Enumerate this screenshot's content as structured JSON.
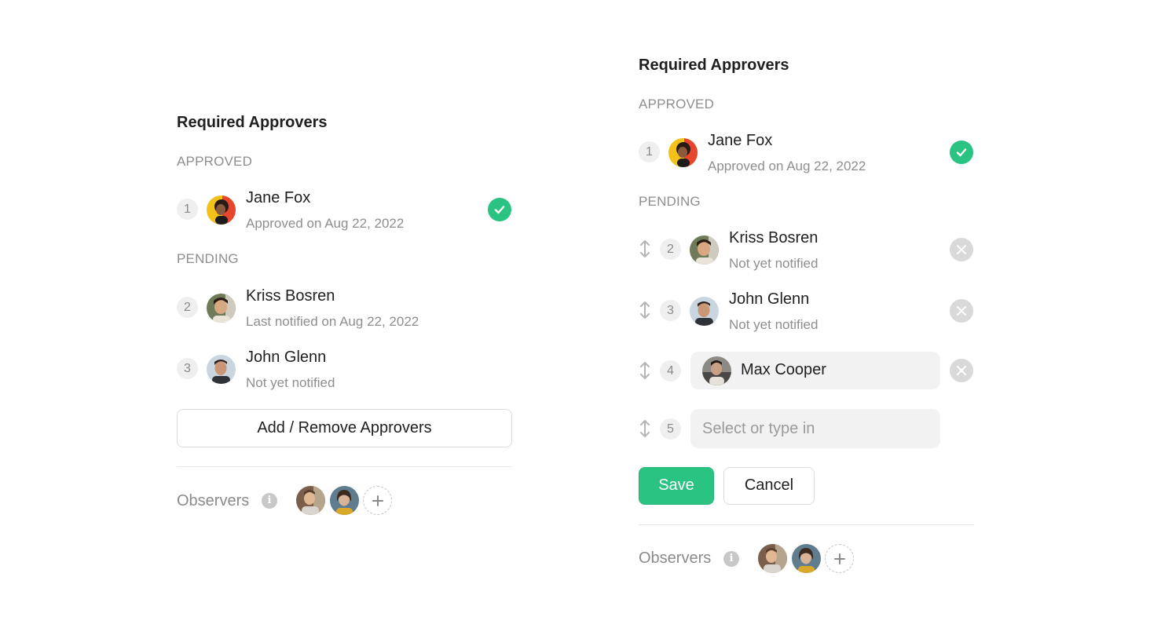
{
  "left": {
    "title": "Required Approvers",
    "approved_label": "APPROVED",
    "pending_label": "PENDING",
    "approved": [
      {
        "num": "1",
        "name": "Jane Fox",
        "status": "Approved on Aug 22, 2022"
      }
    ],
    "pending": [
      {
        "num": "2",
        "name": "Kriss Bosren",
        "status": "Last notified on Aug 22, 2022"
      },
      {
        "num": "3",
        "name": "John Glenn",
        "status": "Not yet notified"
      }
    ],
    "add_remove_label": "Add / Remove Approvers",
    "observers_label": "Observers",
    "info_glyph": "i"
  },
  "right": {
    "title": "Required Approvers",
    "approved_label": "APPROVED",
    "pending_label": "PENDING",
    "approved": [
      {
        "num": "1",
        "name": "Jane Fox",
        "status": "Approved on Aug 22, 2022"
      }
    ],
    "pending": [
      {
        "num": "2",
        "name": "Kriss Bosren",
        "status": "Not yet notified"
      },
      {
        "num": "3",
        "name": "John Glenn",
        "status": "Not yet notified"
      }
    ],
    "editing": [
      {
        "num": "4",
        "name": "Max Cooper"
      },
      {
        "num": "5",
        "placeholder": "Select or type in"
      }
    ],
    "save_label": "Save",
    "cancel_label": "Cancel",
    "observers_label": "Observers",
    "info_glyph": "i"
  },
  "colors": {
    "accent_green": "#2ac381",
    "muted_text": "#8e8e8e",
    "remove_grey": "#d9d9d9"
  },
  "icons": [
    "check-icon",
    "close-icon",
    "drag-handle-icon",
    "info-icon",
    "plus-icon"
  ]
}
